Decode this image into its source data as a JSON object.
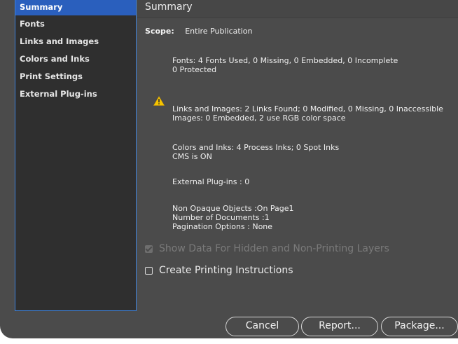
{
  "sidebar": {
    "items": [
      {
        "label": "Summary",
        "selected": true
      },
      {
        "label": "Fonts"
      },
      {
        "label": "Links and Images"
      },
      {
        "label": "Colors and Inks"
      },
      {
        "label": "Print Settings"
      },
      {
        "label": "External Plug-ins"
      }
    ]
  },
  "main": {
    "title": "Summary",
    "scope_label": "Scope:",
    "scope_value": "Entire Publication",
    "fonts_line1": "Fonts: 4 Fonts Used, 0 Missing, 0 Embedded, 0 Incomplete",
    "fonts_line2": "0 Protected",
    "links_line1": "Links and Images: 2 Links Found; 0 Modified, 0 Missing, 0 Inaccessible",
    "links_line2": "Images: 0 Embedded, 2 use RGB color space",
    "colors_line1": "Colors and Inks: 4 Process Inks; 0 Spot Inks",
    "colors_line2": "CMS is ON",
    "plugins_line": "External Plug-ins : 0",
    "nonopaque_line": "Non Opaque Objects :On Page1",
    "documents_line": "Number of Documents :1",
    "pagination_line": "Pagination Options : None",
    "warning_icon": "warning-triangle-icon",
    "show_hidden_label": "Show Data For Hidden and Non-Printing Layers",
    "show_hidden_checked": true,
    "show_hidden_disabled": true,
    "create_instructions_label": "Create Printing Instructions",
    "create_instructions_checked": false
  },
  "buttons": {
    "cancel": "Cancel",
    "report": "Report...",
    "package": "Package..."
  },
  "colors": {
    "window_bg": "#4b4b4b",
    "sidebar_bg": "#2f2f2f",
    "selection": "#2a5fbd",
    "focus_border": "#3d82db",
    "warning": "#f5c400"
  }
}
